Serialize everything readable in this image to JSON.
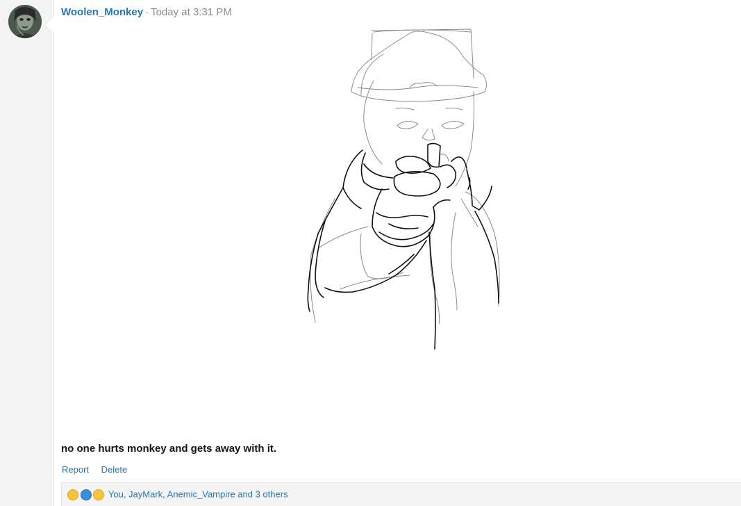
{
  "post": {
    "username": "Woolen_Monkey",
    "separator": "·",
    "timestamp": "Today at 3:31 PM",
    "message": "no one hurts monkey and gets away with it.",
    "actions": {
      "report": "Report",
      "delete": "Delete"
    },
    "reactions": {
      "icons": [
        "laugh-reaction-icon",
        "like-reaction-icon",
        "wow-reaction-icon"
      ],
      "summary": "You, JayMark, Anemic_Vampire and 3 others"
    }
  },
  "colors": {
    "link": "#2577b1",
    "muted": "#8c8c8c",
    "sidebar_bg": "#f4f4f4",
    "text": "#141414"
  }
}
